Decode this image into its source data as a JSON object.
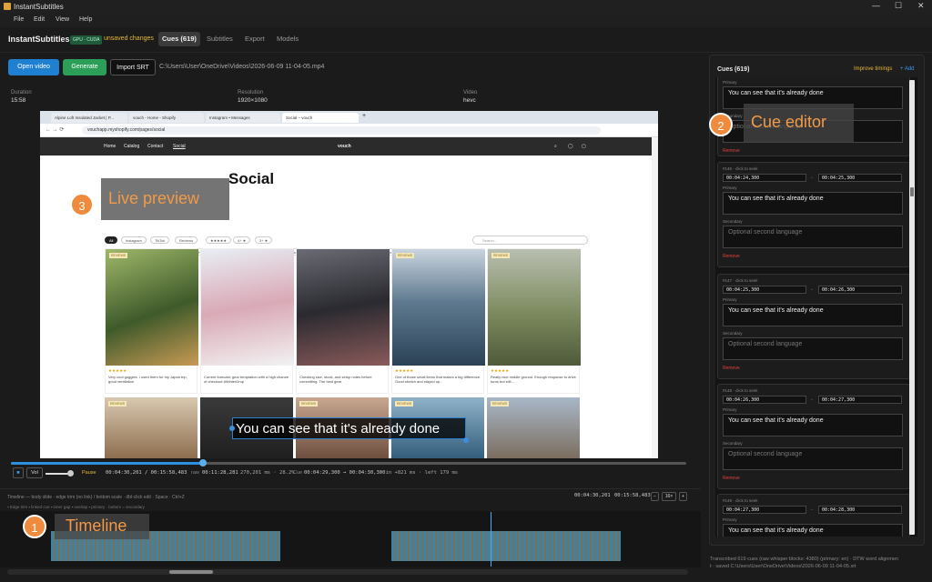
{
  "window": {
    "title": "InstantSubtitles",
    "minimize": "—",
    "maximize": "☐",
    "close": "✕"
  },
  "menu": [
    "File",
    "Edit",
    "View",
    "Help"
  ],
  "header": {
    "brand": "InstantSubtitles",
    "badge": "GPU · CUDA",
    "unsaved": "unsaved changes",
    "tabs": [
      "Cues (619)",
      "Subtitles",
      "Export",
      "Models"
    ]
  },
  "toolbar": {
    "open_video": "Open video",
    "generate": "Generate",
    "import_srt": "Import SRT",
    "file_path": "C:\\Users\\User\\OneDrive\\Videos\\2026-06-09 11-04-05.mp4"
  },
  "info": {
    "duration_label": "Duration",
    "duration_value": "15:58",
    "resolution_label": "Resolution",
    "resolution_value": "1920×1080",
    "video_label": "Video",
    "video_value": "hevc"
  },
  "browser": {
    "tabs": [
      "Alpine Loft Insulated Jacket | P...",
      "vouch - Home - Shopify",
      "Instagram • Messages",
      "Social – vouch"
    ],
    "new_tab": "+",
    "url": "vouchapp.myshopify.com/pages/social"
  },
  "site": {
    "nav": [
      "Home",
      "Catalog",
      "Contact",
      "Social"
    ],
    "logo": "vouch",
    "heading": "Social",
    "filters": [
      "All",
      "Instagram",
      "TikTok",
      "Reviews",
      "★★★★★",
      "4+ ★",
      "3+ ★"
    ],
    "tags": [
      "snowboard",
      "Outerwear",
      "Goggles",
      "Helmets",
      "giftcard",
      "Accessories",
      "accessories",
      "Bibs",
      "Base Layers",
      "Travel Gear",
      "Bindings",
      "Boots"
    ],
    "search_placeholder": "Search...",
    "count": "73 posts",
    "cards": [
      {
        "badge": "REVIEWS",
        "stars": "★★★★★",
        "caption": "Very cool goggles. I used them for my Japan trip, good ventilation"
      },
      {
        "badge": "",
        "stars": "",
        "caption": "Current forecast: gear temptation with a high chance of checkout #WinterDrop"
      },
      {
        "badge": "",
        "stars": "",
        "caption": "Checking size, stock, and setup notes before committing. The best gear"
      },
      {
        "badge": "REVIEWS",
        "stars": "★★★★★",
        "caption": "One of those small items that makes a big difference. Good stretch and stayed up..."
      },
      {
        "badge": "REVIEWS",
        "stars": "★★★★★",
        "caption": "Really nice middle ground. Enough response to drive turns but still..."
      }
    ],
    "row2_badges": [
      "REVIEWS",
      "",
      "REVIEWS",
      "REVIEWS",
      "REVIEWS"
    ]
  },
  "overlay": {
    "live_preview": "Live preview",
    "live_num": "3",
    "cue_editor": "Cue editor",
    "cue_num": "2",
    "timeline": "Timeline",
    "timeline_num": "1",
    "subtitle": "You can see that it's already done"
  },
  "player": {
    "progress": 0.284,
    "stop": "■",
    "volume_label": "Vol",
    "volume": 0.9,
    "pause": "Pause",
    "time": "00:04:30,201 / 00:15:58,483",
    "raw_label": "raw",
    "raw": "00:11:28,281",
    "stats": "270,201 ms · 28.2%",
    "cue_label": "Cue",
    "cue_range": "00:04:29,300 → 00:04:30,300",
    "extra": "· in +821 ms · left 179 ms"
  },
  "timeline": {
    "hint": "Timeline — body slide · edge trim (no link) / bottom scale · dbl-click edit · Space · Ctrl+Z",
    "legend": "▪ Edge trim ▪ linked cue ▪ inner gap ▪ overlap ▪ primary · bottom = secondary",
    "time_a": "00:04:30,201",
    "time_b": "00:15:58,483",
    "zoom_out": "−",
    "zoom": "16×",
    "zoom_in": "+"
  },
  "cues": {
    "title": "Cues (619)",
    "improve": "Improve timings",
    "add": "+ Add",
    "primary_label": "Primary",
    "secondary_label": "Secondary",
    "secondary_placeholder": "Optional second language",
    "remove": "Remove",
    "arrow": "→",
    "items": [
      {
        "seek": "",
        "start": "",
        "end": "",
        "primary": "You can see that it's already done"
      },
      {
        "seek": "#146 · click to seek",
        "start": "00:04:24,300",
        "end": "00:04:25,300",
        "primary": "You can see that it's already done"
      },
      {
        "seek": "#147 · click to seek",
        "start": "00:04:25,300",
        "end": "00:04:26,300",
        "primary": "You can see that it's already done"
      },
      {
        "seek": "#148 · click to seek",
        "start": "00:04:26,300",
        "end": "00:04:27,300",
        "primary": "You can see that it's already done"
      },
      {
        "seek": "#149 · click to seek",
        "start": "00:04:27,300",
        "end": "00:04:28,300",
        "primary": "You can see that it's already done"
      }
    ]
  },
  "footer": {
    "line1": "Transcribed 619 cues (raw whisper blocks: 4380) (primary: en) · DTW word alignmen",
    "line2": "t · saved C:\\Users\\User\\OneDrive\\Videos\\2026-06-09 11-04-05.srt"
  },
  "colors": {
    "accent": "#1f7fd1",
    "green": "#2b9f57",
    "warning": "#e6b838",
    "marker": "#f08a3c",
    "danger": "#e0453a"
  }
}
